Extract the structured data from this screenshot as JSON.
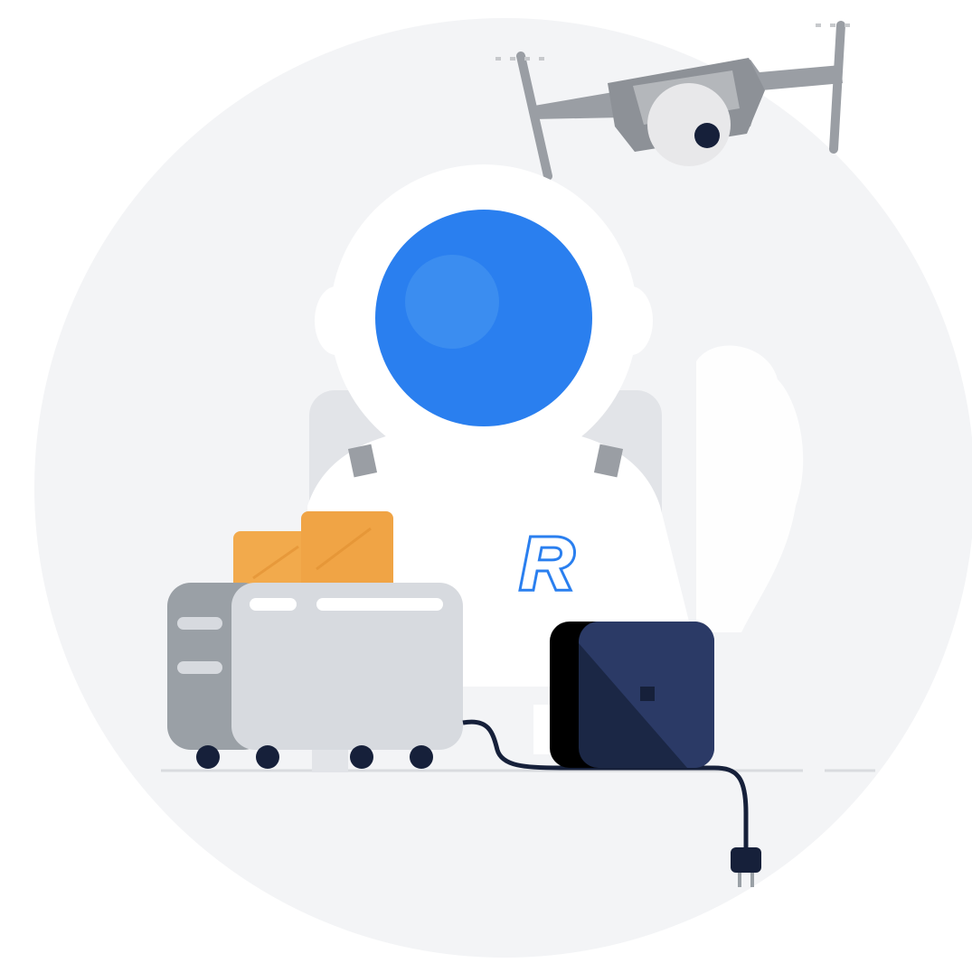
{
  "illustration": {
    "logo_text": "R",
    "colors": {
      "background_circle": "#f3f4f6",
      "helmet_blue": "#2a7fef",
      "helmet_highlight": "#3b8df0",
      "suit_white": "#ffffff",
      "shoulder_grey": "#e2e4e8",
      "toaster_front": "#d7dadf",
      "toaster_side": "#9aa0a6",
      "toast": "#f2aa4c",
      "device_dark": "#1b2745",
      "device_face": "#2b3a66",
      "cable": "#16203a",
      "drone_grey": "#9a9ea4",
      "camera_white": "#e8e8ea"
    },
    "icons": [
      "drone-icon",
      "astronaut-icon",
      "toaster-icon",
      "smart-device-icon",
      "plug-icon",
      "revolut-logo-icon"
    ]
  }
}
